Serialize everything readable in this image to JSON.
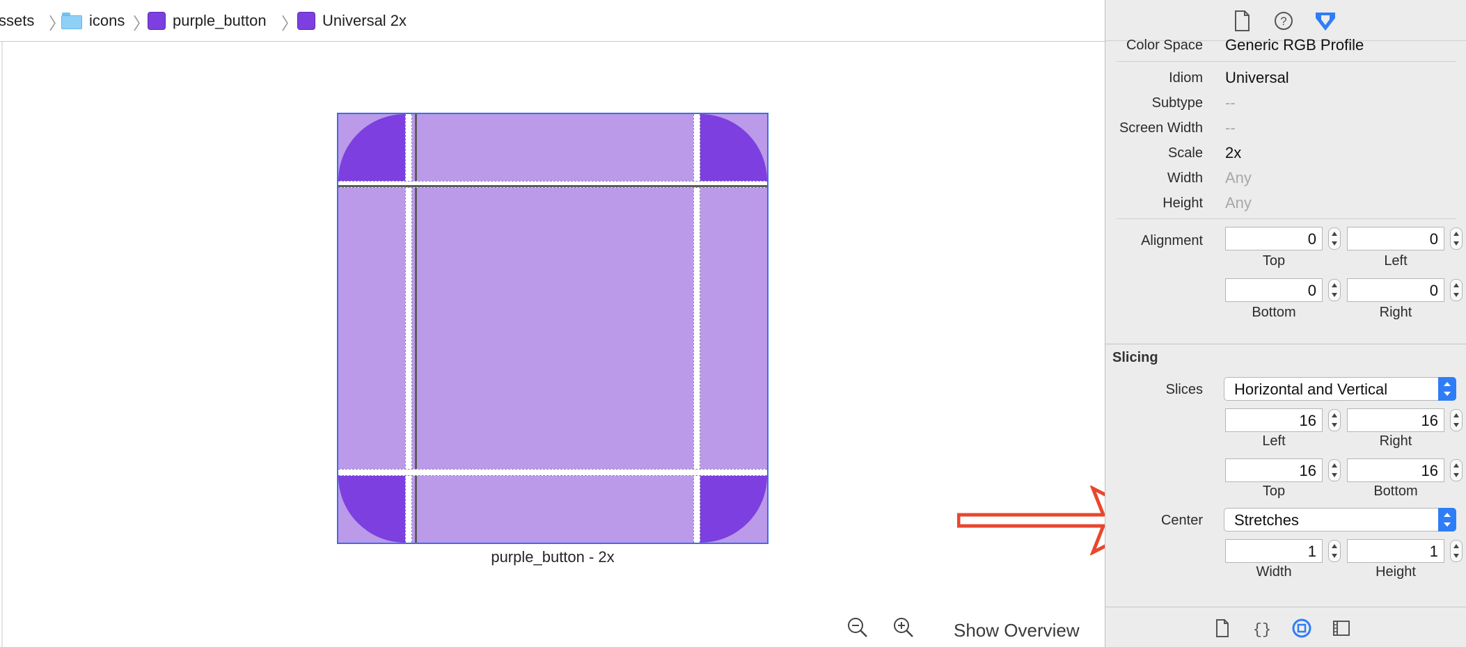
{
  "breadcrumb": {
    "items": [
      {
        "label": "ssets",
        "icon": "none"
      },
      {
        "label": "icons",
        "icon": "folder-icon"
      },
      {
        "label": "purple_button",
        "icon": "image-set-icon"
      },
      {
        "label": "Universal 2x",
        "icon": "image-icon"
      }
    ]
  },
  "preview": {
    "caption": "purple_button - 2x",
    "fill_color": "#bb9ae9",
    "corner_color": "#7d3fe0",
    "selection_color": "#3b6ee8"
  },
  "bottom_bar": {
    "zoom_out_icon": "zoom-out-icon",
    "zoom_in_icon": "zoom-in-icon",
    "show_overview": "Show Overview"
  },
  "inspector": {
    "tabs": [
      "file-inspector-icon",
      "quick-help-icon",
      "attributes-inspector-icon"
    ],
    "properties": [
      {
        "label": "Color Space",
        "value": "Generic RGB Profile",
        "muted": false
      },
      {
        "label": "Idiom",
        "value": "Universal",
        "muted": false
      },
      {
        "label": "Subtype",
        "value": "--",
        "muted": true
      },
      {
        "label": "Screen Width",
        "value": "--",
        "muted": true
      },
      {
        "label": "Scale",
        "value": "2x",
        "muted": false
      },
      {
        "label": "Width",
        "value": "Any",
        "muted": true
      },
      {
        "label": "Height",
        "value": "Any",
        "muted": true
      }
    ],
    "alignment": {
      "label": "Alignment",
      "top": {
        "value": "0",
        "label": "Top"
      },
      "left": {
        "value": "0",
        "label": "Left"
      },
      "bottom": {
        "value": "0",
        "label": "Bottom"
      },
      "right": {
        "value": "0",
        "label": "Right"
      }
    },
    "slicing": {
      "title": "Slicing",
      "slices_label": "Slices",
      "slices_value": "Horizontal and Vertical",
      "left": {
        "value": "16",
        "label": "Left"
      },
      "right": {
        "value": "16",
        "label": "Right"
      },
      "top": {
        "value": "16",
        "label": "Top"
      },
      "bottom": {
        "value": "16",
        "label": "Bottom"
      },
      "center_label": "Center",
      "center_value": "Stretches",
      "width": {
        "value": "1",
        "label": "Width"
      },
      "height": {
        "value": "1",
        "label": "Height"
      }
    },
    "library_tabs": [
      "file-template-icon",
      "code-snippet-icon",
      "object-library-icon",
      "media-library-icon"
    ]
  },
  "annotation": {
    "arrow_color": "#e8472e"
  }
}
